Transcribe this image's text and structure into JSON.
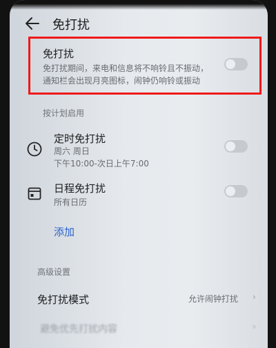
{
  "header": {
    "title": "免打扰"
  },
  "dnd": {
    "title": "免打扰",
    "description_line1": "免打扰期间，来电和信息将不响铃且不振动，",
    "description_line2": "通知栏会出现月亮图标，闹钟仍响铃或振动",
    "enabled": false
  },
  "schedule_section": {
    "label": "按计划启用"
  },
  "timed_dnd": {
    "title": "定时免打扰",
    "days": "周六 周日",
    "time_range": "下午10:00-次日上午7:00",
    "enabled": false
  },
  "calendar_dnd": {
    "title": "日程免打扰",
    "calendar": "所有日历",
    "enabled": false
  },
  "add_label": "添加",
  "advanced_section": {
    "label": "高级设置"
  },
  "dnd_mode": {
    "title": "免打扰模式",
    "value": "允许闹钟打扰"
  },
  "blurred_item": {
    "title": "避免优先打扰内容"
  },
  "colors": {
    "accent": "#2a63c9",
    "highlight_border": "#f01818"
  }
}
